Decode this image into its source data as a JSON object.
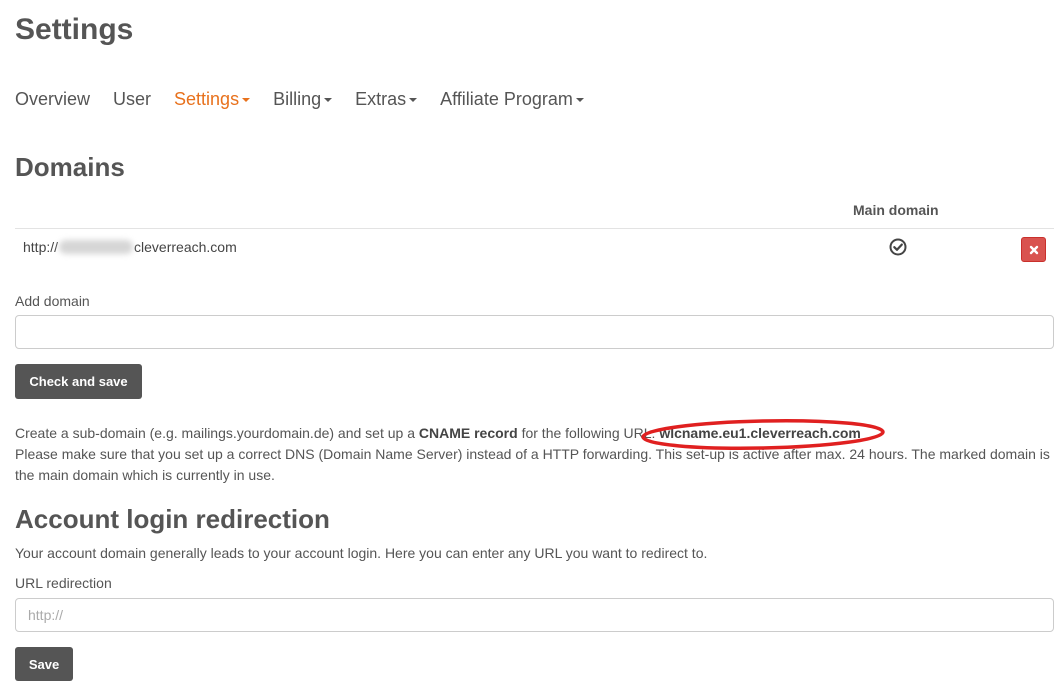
{
  "page": {
    "title": "Settings"
  },
  "nav": {
    "items": [
      {
        "label": "Overview",
        "dropdown": false,
        "active": false
      },
      {
        "label": "User",
        "dropdown": false,
        "active": false
      },
      {
        "label": "Settings",
        "dropdown": true,
        "active": true
      },
      {
        "label": "Billing",
        "dropdown": true,
        "active": false
      },
      {
        "label": "Extras",
        "dropdown": true,
        "active": false
      },
      {
        "label": "Affiliate Program",
        "dropdown": true,
        "active": false
      }
    ]
  },
  "domains": {
    "heading": "Domains",
    "column_header": "Main domain",
    "rows": [
      {
        "prefix": "http://",
        "suffix": "cleverreach.com",
        "is_main": true,
        "delete_icon": "times-icon"
      }
    ],
    "add_label": "Add domain",
    "add_value": "",
    "save_button": "Check and save",
    "info_line1_pre": "Create a sub-domain (e.g. mailings.yourdomain.de) and set up a ",
    "info_line1_bold": "CNAME record",
    "info_line1_post": " for the following URL:",
    "cname_url": "wlcname.eu1.cleverreach.com",
    "info_line2": "Please make sure that you set up a correct DNS (Domain Name Server) instead of a HTTP forwarding. This set-up is active after max. 24 hours. The marked domain is the main domain which is currently in use."
  },
  "redirection": {
    "heading": "Account login redirection",
    "description": "Your account domain generally leads to your account login. Here you can enter any URL you want to redirect to.",
    "url_label": "URL redirection",
    "url_placeholder": "http://",
    "url_value": "",
    "save_button": "Save"
  },
  "colors": {
    "accent": "#e8711c",
    "dark_button": "#555555",
    "danger": "#d9534f",
    "highlight_ellipse": "#e02020"
  }
}
